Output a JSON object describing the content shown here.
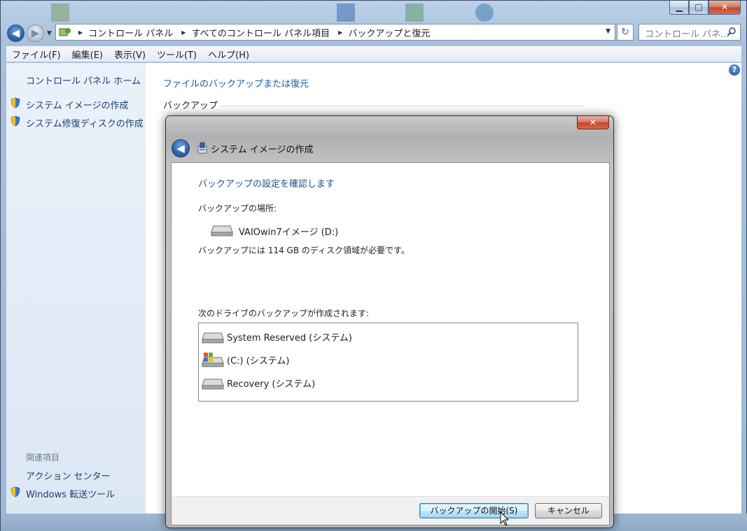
{
  "explorer": {
    "caption_buttons": {
      "minimize": "▁",
      "maximize": "□",
      "close": "✕"
    },
    "nav": {
      "back_glyph": "◀",
      "forward_glyph": "▶"
    },
    "breadcrumbs": [
      "コントロール パネル",
      "すべてのコントロール パネル項目",
      "バックアップと復元"
    ],
    "search_placeholder": "コントロール パネ...",
    "menu": [
      "ファイル(F)",
      "編集(E)",
      "表示(V)",
      "ツール(T)",
      "ヘルプ(H)"
    ],
    "sidebar": {
      "home": "コントロール パネル ホーム",
      "tasks": [
        "システム イメージの作成",
        "システム修復ディスクの作成"
      ],
      "related_heading": "関連項目",
      "related": [
        "アクション センター",
        "Windows 転送ツール"
      ]
    },
    "main": {
      "link": "ファイルのバックアップまたは復元",
      "section": "バックアップ"
    }
  },
  "dialog": {
    "title": "システム イメージの作成",
    "close_glyph": "✕",
    "heading": "バックアップの設定を確認します",
    "location_label": "バックアップの場所:",
    "location_drive": "VAIOwin7イメージ (D:)",
    "size_text": "バックアップには 114 GB のディスク領域が必要です。",
    "drives_label": "次のドライブのバックアップが作成されます:",
    "drives": [
      "System Reserved (システム)",
      "(C:) (システム)",
      "Recovery (システム)"
    ],
    "buttons": {
      "start": "バックアップの開始(S)",
      "cancel": "キャンセル"
    }
  },
  "colors": {
    "link": "#1f58a6",
    "heading": "#1f4f8f",
    "sidebar": "#dce7f4"
  }
}
